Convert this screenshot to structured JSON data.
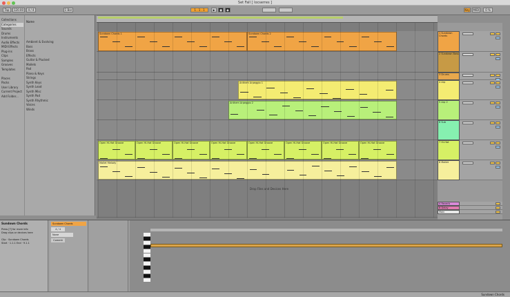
{
  "window": {
    "title": "Set Fall [ locserres ]"
  },
  "toolbar": {
    "left_buttons": [
      "Tap",
      "120.00",
      "4 / 4",
      "1 Bar"
    ],
    "transport": [
      "▶",
      "■",
      "●"
    ],
    "position": "1 . 1 . 1",
    "right_buttons": [
      "Key",
      "MIDI",
      "0 %"
    ]
  },
  "browser": {
    "places": [
      "Collections",
      "Categories",
      "Sounds",
      "Drums",
      "Instruments",
      "Audio Effects",
      "MIDI Effects",
      "Plug-ins",
      "Clips",
      "Samples",
      "Grooves",
      "Templates",
      "",
      "Places",
      "Packs",
      "User Library",
      "Current Project",
      "Add Folder..."
    ],
    "header": "Name",
    "items": [
      "Ambient & Evolving",
      "Bass",
      "Brass",
      "Effects",
      "Guitar & Plucked",
      "Mallets",
      "Pad",
      "Piano & Keys",
      "Strings",
      "Synth Keys",
      "Synth Lead",
      "Synth Misc",
      "Synth Pad",
      "Synth Rhythmic",
      "Voices",
      "Winds"
    ]
  },
  "tracks": [
    {
      "clips": [
        "Sundown Chords 1",
        "Sundown Chords 2"
      ],
      "color": "#f0a445",
      "header": "1 Sundown Chords",
      "header_color": "#f0a445"
    },
    {
      "clips": [
        "Sundown Bass",
        "Sundown Bass",
        "Sundown Bass",
        "Sundown Bass"
      ],
      "color": "#d9a34a",
      "header": "2 Sundown Bass",
      "header_color": "#c79a45"
    },
    {
      "clips": [],
      "color": "#8a8a8a",
      "header": "3 Drums",
      "header_color": "#e8a84c"
    },
    {
      "clips": [
        "Anthem Arpeggio 1"
      ],
      "color": "#f4ec72",
      "header": "4 Arp",
      "header_color": "#f4ec72"
    },
    {
      "clips": [
        "Anthem Arpeggio 2"
      ],
      "color": "#b8f07a",
      "header": "5 Arp 2",
      "header_color": "#b8f07a"
    },
    {
      "clips": [
        "Sub Bass",
        "Sub Bass"
      ],
      "color": "#86f0b0",
      "header": "6 Sub",
      "header_color": "#86f0b0"
    },
    {
      "clips": [
        "Open Hi-Hat Groove",
        "Open Hi-Hat Groove",
        "Open Hi-Hat Groove",
        "Open Hi-Hat Groove",
        "Open Hi-Hat Groove",
        "Open Hi-Hat Groove",
        "Open Hi-Hat Groove",
        "Open Hi-Hat Groove"
      ],
      "color": "#d6f065",
      "header": "7 Hi-Hat",
      "header_color": "#d6f065"
    },
    {
      "clips": [
        "Mallet Melody"
      ],
      "color": "#f6ef9c",
      "header": "8 Mallet",
      "header_color": "#f6ef9c"
    }
  ],
  "drop_hint": "Drop Files and Devices Here",
  "returns": [
    {
      "header": "A Reverb",
      "color": "#d88ad8"
    },
    {
      "header": "B Delay",
      "color": "#e07ab0"
    },
    {
      "header": "Main",
      "color": "#e8e8e8"
    }
  ],
  "detail": {
    "info_title": "Sundown Chords",
    "info_lines": [
      "Press [?] for more info",
      "Drag clips or devices here",
      "",
      "Clip · Sundown Chords",
      "Start · 1.1.1  End · 9.1.1"
    ],
    "clip_name": "Sundown Chords",
    "signature": "4 / 4",
    "groove": "None",
    "commit": "Commit"
  },
  "status": {
    "left": "",
    "right": "Sundown Chords"
  }
}
